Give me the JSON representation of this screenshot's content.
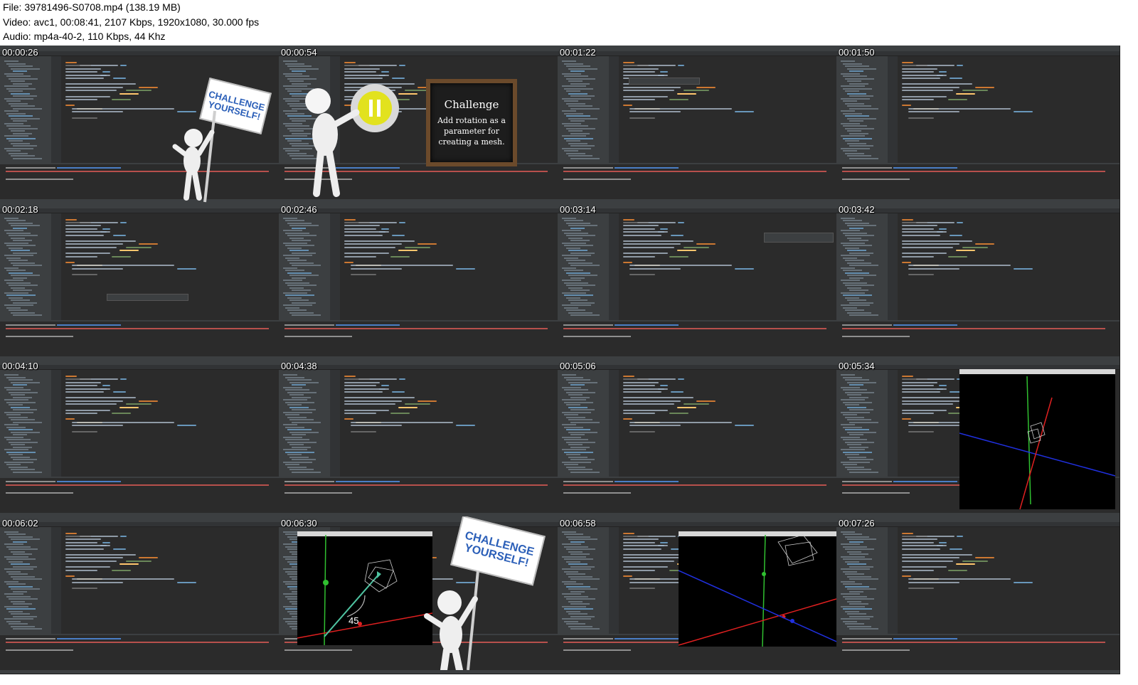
{
  "header": {
    "file_line": "File: 39781496-S0708.mp4 (138.19 MB)",
    "video_line": "Video: avc1, 00:08:41, 2107 Kbps, 1920x1080, 30.000 fps",
    "audio_line": "Audio: mp4a-40-2, 110 Kbps, 44 Khz"
  },
  "thumbnails": [
    {
      "timestamp": "00:00:26",
      "overlay": "challenge-sign"
    },
    {
      "timestamp": "00:00:54",
      "overlay": "blackboard"
    },
    {
      "timestamp": "00:01:22",
      "overlay": "autocomplete"
    },
    {
      "timestamp": "00:01:50",
      "overlay": "none"
    },
    {
      "timestamp": "00:02:18",
      "overlay": "autocomplete"
    },
    {
      "timestamp": "00:02:46",
      "overlay": "none"
    },
    {
      "timestamp": "00:03:14",
      "overlay": "tooltip"
    },
    {
      "timestamp": "00:03:42",
      "overlay": "none"
    },
    {
      "timestamp": "00:04:10",
      "overlay": "none"
    },
    {
      "timestamp": "00:04:38",
      "overlay": "none"
    },
    {
      "timestamp": "00:05:06",
      "overlay": "none"
    },
    {
      "timestamp": "00:05:34",
      "overlay": "viewport-small"
    },
    {
      "timestamp": "00:06:02",
      "overlay": "none"
    },
    {
      "timestamp": "00:06:30",
      "overlay": "viewport-sign"
    },
    {
      "timestamp": "00:06:58",
      "overlay": "viewport-wide"
    },
    {
      "timestamp": "00:07:26",
      "overlay": "none"
    }
  ],
  "sign_text": "CHALLENGE YOURSELF!",
  "blackboard": {
    "title": "Challenge",
    "body": "Add rotation as a parameter for creating a mesh."
  },
  "angle_label": "45",
  "colors": {
    "ide_background": "#2b2b2b",
    "ide_panel": "#3c3f41",
    "keyword": "#cc7832",
    "function": "#ffc66d",
    "number": "#6897bb",
    "sign_text": "#2b5fb8",
    "axis_x": "#e02020",
    "axis_y": "#30c030",
    "axis_z": "#2030e0"
  }
}
